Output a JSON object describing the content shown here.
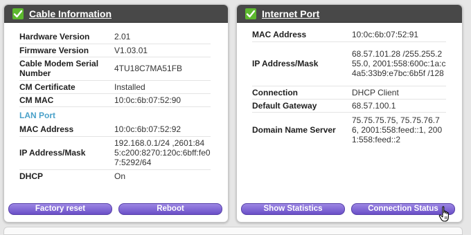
{
  "cable": {
    "title": "Cable Information",
    "rows": [
      {
        "label": "Hardware Version",
        "value": "2.01"
      },
      {
        "label": "Firmware Version",
        "value": "V1.03.01"
      },
      {
        "label": "Cable Modem Serial Number",
        "value": "4TU18C7MA51FB"
      },
      {
        "label": "CM Certificate",
        "value": "Installed"
      },
      {
        "label": "CM MAC",
        "value": "10:0c:6b:07:52:90"
      }
    ],
    "lan_title": "LAN Port",
    "lan_rows": [
      {
        "label": "MAC Address",
        "value": "10:0c:6b:07:52:92"
      },
      {
        "label": "IP Address/Mask",
        "value": "192.168.0.1/24 ,2601:845:c200:8270:120c:6bff:fe07:5292/64"
      },
      {
        "label": "DHCP",
        "value": "On"
      }
    ],
    "buttons": {
      "factory_reset": "Factory reset",
      "reboot": "Reboot"
    }
  },
  "internet": {
    "title": "Internet Port",
    "rows": [
      {
        "label": "MAC Address",
        "value": "10:0c:6b:07:52:91"
      },
      {
        "label": "IP Address/Mask",
        "value": "68.57.101.28 /255.255.255.0, 2001:558:600c:1a:c4a5:33b9:e7bc:6b5f /128"
      },
      {
        "label": "Connection",
        "value": "DHCP Client"
      },
      {
        "label": "Default Gateway",
        "value": "68.57.100.1"
      },
      {
        "label": "Domain Name Server",
        "value": "75.75.75.75, 75.75.76.76, 2001:558:feed::1, 2001:558:feed::2"
      }
    ],
    "buttons": {
      "show_statistics": "Show Statistics",
      "connection_status": "Connection Status"
    }
  },
  "colors": {
    "check_green": "#5cb82e",
    "header_bg": "#484848",
    "section_blue": "#4aa1c9",
    "button_purple": "#7b61d4"
  },
  "icons": {
    "check": "green-checkmark-icon",
    "cursor": "hand-pointer-cursor-icon"
  }
}
